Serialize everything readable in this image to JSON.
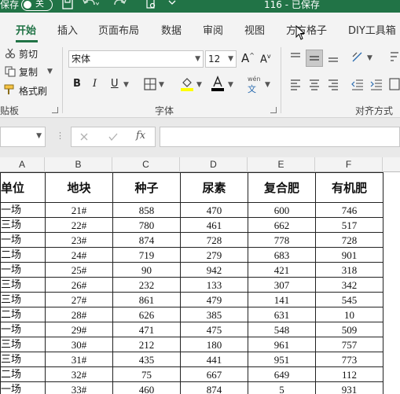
{
  "titlebar": {
    "autosave_label": "保存",
    "autosave_state": "关",
    "document_title": "116 - 已保存"
  },
  "tabs": [
    {
      "label": "开始",
      "active": true
    },
    {
      "label": "插入"
    },
    {
      "label": "页面布局"
    },
    {
      "label": "数据"
    },
    {
      "label": "审阅"
    },
    {
      "label": "视图"
    },
    {
      "label": "方方格子"
    },
    {
      "label": "DIY工具箱"
    }
  ],
  "ribbon": {
    "clipboard": {
      "cut": "剪切",
      "copy": "复制",
      "format_painter": "格式刷",
      "group_label": "贴板"
    },
    "font": {
      "font_name": "宋体",
      "font_size": "12",
      "grow": "A",
      "shrink": "A",
      "bold": "B",
      "italic": "I",
      "underline": "U",
      "phonetic": "wén",
      "phonetic_char": "文",
      "group_label": "字体",
      "fill_color": "#ffff00",
      "font_color": "#000000"
    },
    "alignment": {
      "group_label": "对齐方式"
    }
  },
  "formula_bar": {
    "fx": "fx",
    "value": ""
  },
  "columns": [
    "A",
    "B",
    "C",
    "D",
    "E",
    "F"
  ],
  "table": {
    "headers": [
      "单位",
      "地块",
      "种子",
      "尿素",
      "复合肥",
      "有机肥"
    ],
    "rows": [
      [
        "一场",
        "21#",
        "858",
        "470",
        "600",
        "746"
      ],
      [
        "三场",
        "22#",
        "780",
        "461",
        "662",
        "517"
      ],
      [
        "一场",
        "23#",
        "874",
        "728",
        "778",
        "728"
      ],
      [
        "二场",
        "24#",
        "719",
        "279",
        "683",
        "901"
      ],
      [
        "一场",
        "25#",
        "90",
        "942",
        "421",
        "318"
      ],
      [
        "三场",
        "26#",
        "232",
        "133",
        "307",
        "342"
      ],
      [
        "三场",
        "27#",
        "861",
        "479",
        "141",
        "545"
      ],
      [
        "二场",
        "28#",
        "626",
        "385",
        "631",
        "10"
      ],
      [
        "一场",
        "29#",
        "471",
        "475",
        "548",
        "509"
      ],
      [
        "三场",
        "30#",
        "212",
        "180",
        "961",
        "757"
      ],
      [
        "三场",
        "31#",
        "435",
        "441",
        "951",
        "773"
      ],
      [
        "二场",
        "32#",
        "75",
        "667",
        "649",
        "112"
      ],
      [
        "一场",
        "33#",
        "460",
        "874",
        "5",
        "931"
      ]
    ]
  },
  "colors": {
    "accent": "#217346",
    "ribbon_bg": "#f3f3f3"
  }
}
